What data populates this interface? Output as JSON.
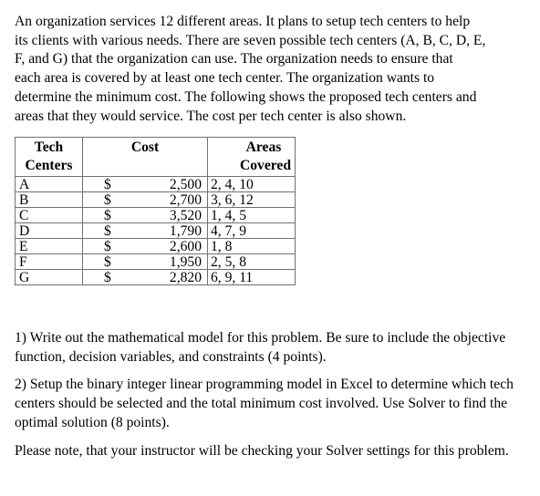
{
  "intro": {
    "text": "An organization services 12 different areas.   It plans to setup tech centers to help\nits clients with various needs.  There are seven possible tech centers (A, B, C, D, E,\nF, and G) that the organization can use.    The organization needs to ensure that\neach area is covered by at least one tech center.   The organization wants to\ndetermine the minimum cost.   The following shows the proposed tech centers and\nareas that they would service.   The cost per tech center is also shown."
  },
  "table": {
    "headers": {
      "center_line1": "Tech",
      "center_line2": "Centers",
      "cost": "Cost",
      "areas_line1": "Areas",
      "areas_line2": "Covered"
    },
    "currency_symbol": "$",
    "rows": [
      {
        "center": "A",
        "cost": "2,500",
        "areas": "2, 4, 10"
      },
      {
        "center": "B",
        "cost": "2,700",
        "areas": "3, 6, 12"
      },
      {
        "center": "C",
        "cost": "3,520",
        "areas": "1, 4, 5"
      },
      {
        "center": "D",
        "cost": "1,790",
        "areas": "4, 7, 9"
      },
      {
        "center": "E",
        "cost": "2,600",
        "areas": "1, 8"
      },
      {
        "center": "F",
        "cost": "1,950",
        "areas": "2, 5, 8"
      },
      {
        "center": "G",
        "cost": "2,820",
        "areas": "6, 9, 11"
      }
    ]
  },
  "questions": {
    "q1": "1) Write out the mathematical model for this problem.  Be sure to include the objective function, decision variables, and constraints (4 points).",
    "q2": "2) Setup the binary integer linear programming model in Excel to determine which tech centers should be selected and the total minimum cost involved.   Use Solver to find the optimal solution (8 points).",
    "note": "Please note, that your instructor will be checking your Solver settings for this problem."
  }
}
